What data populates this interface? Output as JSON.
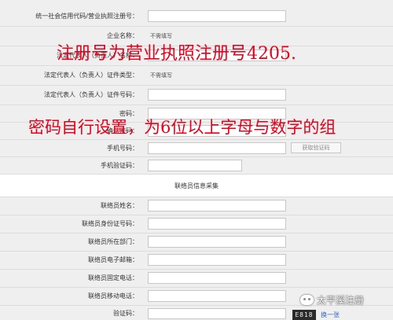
{
  "rows": [
    {
      "label": "统一社会信用代码/营业执照注册号：",
      "type": "input"
    },
    {
      "label": "企业名称：",
      "type": "value",
      "value": "不需填写"
    },
    {
      "label": "法定代表人（负责人）名称：",
      "type": "input"
    },
    {
      "label": "法定代表人（负责人）证件类型：",
      "type": "value",
      "value": "不需填写"
    },
    {
      "label": "法定代表人（负责人）证件号码：",
      "type": "input"
    },
    {
      "label": "密码：",
      "type": "input"
    },
    {
      "label": "确认密码：",
      "type": "input"
    },
    {
      "label": "手机号码：",
      "type": "input",
      "button": "获取验证码"
    },
    {
      "label": "手机验证码：",
      "type": "input"
    }
  ],
  "section_title": "联络员信息采集",
  "contact_rows": [
    {
      "label": "联络员姓名："
    },
    {
      "label": "联络员身份证号码："
    },
    {
      "label": "联络员所在部门："
    },
    {
      "label": "联络员电子邮箱："
    },
    {
      "label": "联络员固定电话："
    },
    {
      "label": "联络员移动电话："
    }
  ],
  "captcha": {
    "label": "验证码：",
    "code": "E818",
    "refresh": "换一张"
  },
  "overlays": {
    "line1": "注册号为营业执照注册号4205.",
    "line2": "密码自行设置，为6位以上字母与数字的组"
  },
  "watermark": "太平溪注册"
}
